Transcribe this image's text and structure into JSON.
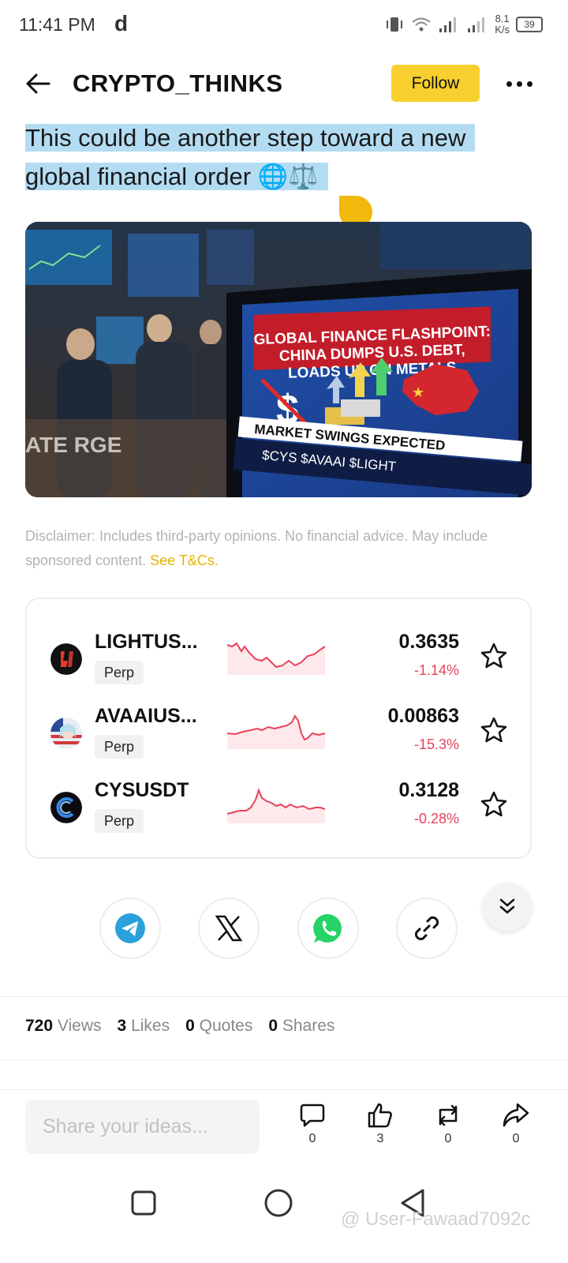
{
  "status_bar": {
    "time": "11:41 PM",
    "app_glyph": "d",
    "net_speed_value": "8.1",
    "net_speed_unit": "K/s",
    "battery": "39"
  },
  "header": {
    "title": "CRYPTO_THINKS",
    "follow_label": "Follow"
  },
  "post": {
    "text": "This could be another step toward a new global financial order 🌐⚖️",
    "image_caption_lines": [
      "GLOBAL FINANCE FLASHPOINT:",
      "CHINA DUMPS U.S. DEBT,",
      "LOADS UP ON METALS"
    ],
    "image_ticker_banner": "MARKET SWINGS EXPECTED",
    "image_ticker_symbols": "$CYS  $AVAAI  $LIGHT",
    "image_wall_text": "ATE   RGE"
  },
  "disclaimer": {
    "text": "Disclaimer: Includes third-party opinions. No financial advice. May include sponsored content. ",
    "link": "See T&Cs."
  },
  "markets": [
    {
      "symbol": "LIGHTUS...",
      "type": "Perp",
      "price": "0.3635",
      "change": "-1.14%",
      "change_color": "#e8425a"
    },
    {
      "symbol": "AVAAIUS...",
      "type": "Perp",
      "price": "0.00863",
      "change": "-15.3%",
      "change_color": "#e8425a"
    },
    {
      "symbol": "CYSUSDT",
      "type": "Perp",
      "price": "0.3128",
      "change": "-0.28%",
      "change_color": "#e8425a"
    }
  ],
  "share_targets": [
    {
      "name": "Telegram",
      "icon": "telegram-icon"
    },
    {
      "name": "X",
      "icon": "x-logo-icon"
    },
    {
      "name": "WhatsApp",
      "icon": "whatsapp-icon"
    },
    {
      "name": "Copy link",
      "icon": "link-icon"
    }
  ],
  "stats": {
    "views_count": "720",
    "views_label": "Views",
    "likes_count": "3",
    "likes_label": "Likes",
    "quotes_count": "0",
    "quotes_label": "Quotes",
    "shares_count": "0",
    "shares_label": "Shares"
  },
  "reply": {
    "placeholder": "Share your ideas..."
  },
  "actions": {
    "comments": "0",
    "likes": "3",
    "reposts": "0",
    "shares": "0"
  },
  "watermark": "@ User-Fawaad7092c",
  "colors": {
    "accent": "#f7cf2e",
    "negative": "#e8425a",
    "selection": "#b3dcf2",
    "link": "#e6b400"
  }
}
